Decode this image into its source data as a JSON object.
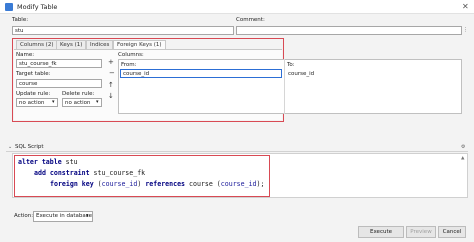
{
  "window": {
    "title": "Modify Table",
    "close": "✕"
  },
  "table": {
    "label": "Table:",
    "value": "stu"
  },
  "comment": {
    "label": "Comment:",
    "value": ""
  },
  "tabs": [
    "Columns (2)",
    "Keys (1)",
    "Indices",
    "Foreign Keys (1)"
  ],
  "fk": {
    "name_label": "Name:",
    "name_value": "stu_course_fk",
    "target_label": "Target table:",
    "target_value": "course",
    "update_label": "Update rule:",
    "update_value": "no action",
    "delete_label": "Delete rule:",
    "delete_value": "no action",
    "columns_label": "Columns:",
    "from_label": "From:",
    "from_value": "course_id",
    "to_label": "To:",
    "to_value": "course_id"
  },
  "sql": {
    "header": "SQL Script",
    "line1_kw": "alter table",
    "line1_rest": " stu",
    "line2_kw": "add constraint",
    "line2_rest": " stu_course_fk",
    "line3_kw1": "foreign key",
    "line3_col1": "course_id",
    "line3_kw2": "references",
    "line3_tbl": "course",
    "line3_col2": "course_id"
  },
  "footer": {
    "action_label": "Action:",
    "action_value": "Execute in database",
    "execute": "Execute",
    "preview": "Preview",
    "cancel": "Cancel"
  }
}
